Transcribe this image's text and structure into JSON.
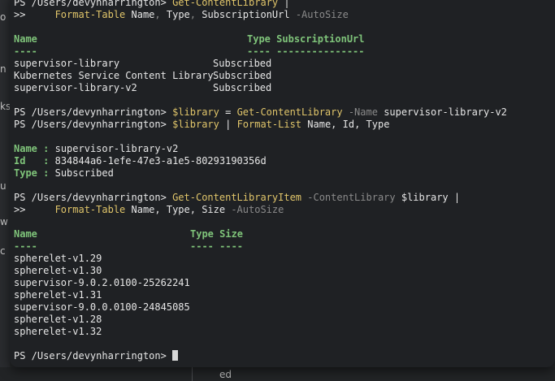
{
  "background_app": {
    "left_labels": [
      "o",
      "n",
      "ks",
      "u",
      "w",
      "c"
    ],
    "bottom_text": "ed"
  },
  "terminal": {
    "prompt": "PS /Users/devynharrington> ",
    "continuation": ">>     ",
    "block1": {
      "line1_cmd": "Get-ContentLibrary",
      "line1_tail": " |",
      "line2_cmd": "Format-Table",
      "line2_args": [
        " Name",
        ",",
        " Type",
        ",",
        " SubscriptionUrl"
      ],
      "line2_param": " -AutoSize",
      "headers": [
        "Name",
        "Type",
        "SubscriptionUrl"
      ],
      "underline": [
        "----",
        "----",
        "---------------"
      ],
      "rows": [
        {
          "name": "supervisor-library",
          "type": "Subscribed"
        },
        {
          "name": "Kubernetes Service Content Library",
          "type": "Subscribed"
        },
        {
          "name": "supervisor-library-v2",
          "type": "Subscribed"
        }
      ]
    },
    "block2": {
      "var": "$library",
      "eq": " = ",
      "cmd": "Get-ContentLibrary",
      "param": " -Name",
      "arg": " supervisor-library-v2"
    },
    "block3": {
      "var": "$library",
      "pipe": " | ",
      "cmd": "Format-List",
      "args": " Name, Id, Type",
      "list": [
        {
          "key": "Name",
          "sep": " : ",
          "value": "supervisor-library-v2"
        },
        {
          "key": "Id  ",
          "sep": " : ",
          "value": "834844a6-1efe-47e3-a1e5-80293190356d"
        },
        {
          "key": "Type",
          "sep": " : ",
          "value": "Subscribed"
        }
      ]
    },
    "block4": {
      "line1_cmd": "Get-ContentLibraryItem",
      "line1_param": " -ContentLibrary",
      "line1_var": " $library",
      "line1_tail": " |",
      "line2_cmd": "Format-Table",
      "line2_args": " Name, Type, Size",
      "line2_param": " -AutoSize",
      "headers": [
        "Name",
        "Type Size"
      ],
      "underline": [
        "----",
        "---- ----"
      ],
      "items": [
        "spherelet-v1.29",
        "spherelet-v1.30",
        "supervisor-9.0.2.0100-25262241",
        "spherelet-v1.31",
        "supervisor-9.0.0.0100-24845085",
        "spherelet-v1.28",
        "spherelet-v1.32"
      ]
    },
    "final_prompt": "PS /Users/devynharrington> "
  }
}
